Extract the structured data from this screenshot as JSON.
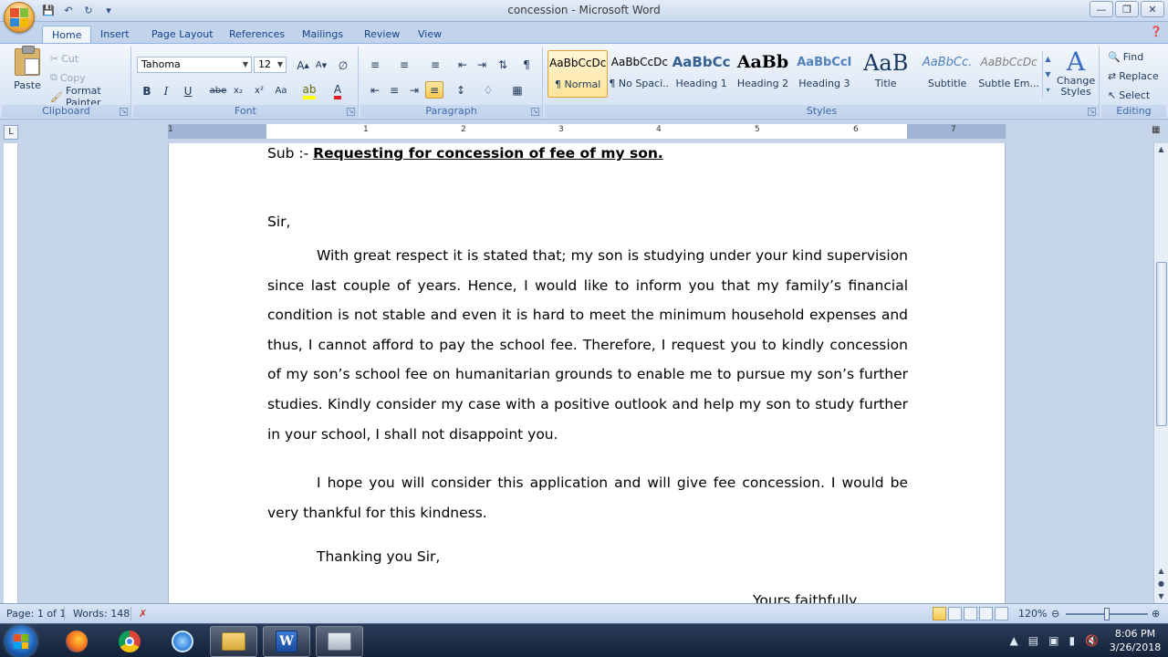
{
  "window": {
    "title": "concession - Microsoft Word"
  },
  "qat": {
    "save": "save-icon",
    "undo": "undo-icon",
    "redo": "redo-icon",
    "customize": "dropdown-icon"
  },
  "tabs": [
    {
      "label": "Home",
      "active": true
    },
    {
      "label": "Insert"
    },
    {
      "label": "Page Layout"
    },
    {
      "label": "References"
    },
    {
      "label": "Mailings"
    },
    {
      "label": "Review"
    },
    {
      "label": "View"
    }
  ],
  "clipboard": {
    "paste": "Paste",
    "cut": "Cut",
    "copy": "Copy",
    "format_painter": "Format Painter",
    "group": "Clipboard"
  },
  "font": {
    "name": "Tahoma",
    "size": "12",
    "group": "Font"
  },
  "paragraph": {
    "group": "Paragraph"
  },
  "styles": {
    "group": "Styles",
    "items": [
      {
        "sample": "AaBbCcDc",
        "name": "¶ Normal"
      },
      {
        "sample": "AaBbCcDc",
        "name": "¶ No Spaci..."
      },
      {
        "sample": "AaBbCc",
        "name": "Heading 1"
      },
      {
        "sample": "AaBb",
        "name": "Heading 2"
      },
      {
        "sample": "AaBbCcI",
        "name": "Heading 3"
      },
      {
        "sample": "AaB",
        "name": "Title"
      },
      {
        "sample": "AaBbCc.",
        "name": "Subtitle"
      },
      {
        "sample": "AaBbCcDc",
        "name": "Subtle Em..."
      }
    ],
    "change_styles_line1": "Change",
    "change_styles_line2": "Styles"
  },
  "editing": {
    "find": "Find",
    "replace": "Replace",
    "select": "Select",
    "group": "Editing"
  },
  "ruler": {
    "numbers": [
      "1",
      "1",
      "2",
      "3",
      "4",
      "5",
      "6",
      "7"
    ]
  },
  "document": {
    "subject_prefix": "Sub :- ",
    "subject_text": "Requesting for concession of fee of my son.",
    "salutation": "Sir,",
    "paragraph1": "With great respect it is stated that; my son is studying under your kind supervision since last couple of years. Hence, I would like to inform you that my family’s financial condition is not stable and even it is hard to meet the minimum household expenses and thus, I cannot afford to pay the school fee. Therefore, I request you to kindly concession of my son’s school fee on humanitarian grounds to enable me to pursue my son’s further studies. Kindly consider my case with a positive outlook and help my son to study further in your school, I shall not disappoint you.",
    "paragraph2": "I hope you will consider this application and will give fee concession. I would be very thankful for this kindness.",
    "thanks": "Thanking you Sir,",
    "closing": "Yours faithfully"
  },
  "status": {
    "page": "Page: 1 of 1",
    "words": "Words: 148",
    "zoom": "120%"
  },
  "taskbar": {
    "apps": [
      "firefox-icon",
      "chrome-icon",
      "chrome-icon",
      "file-explorer-icon",
      "word-icon",
      "app-window-icon"
    ],
    "time": "8:06 PM",
    "date": "3/26/2018"
  },
  "colors": {
    "ribbon_accent": "#15428b",
    "selection": "#f8c94f"
  }
}
